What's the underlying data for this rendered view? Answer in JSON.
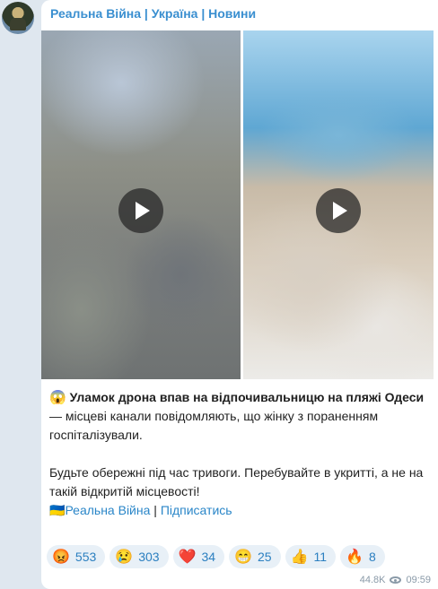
{
  "channel": {
    "title": "Реальна Війна | Україна | Новини",
    "avatar_icon": "soldier-avatar-icon"
  },
  "media": {
    "videos": [
      {
        "play_icon": "play-icon",
        "thumb": "beach-street-video"
      },
      {
        "play_icon": "play-icon",
        "thumb": "beach-sea-video"
      }
    ]
  },
  "post": {
    "headline_emoji": "😱",
    "headline": "Уламок дрона впав на відпочивальницю на пляжі Одеси",
    "headline_rest": " — місцеві канали повідомляють, що жінку з пораненням госпіталізували.",
    "paragraph2": "Будьте обережні під час тривоги. Перебувайте в укритті, а не на такій відкритій місцевості!",
    "flag_emoji": "🇺🇦",
    "channel_link": "Реальна Війна",
    "separator": " | ",
    "subscribe_link": "Підписатись"
  },
  "reactions": [
    {
      "emoji": "😡",
      "count": "553"
    },
    {
      "emoji": "😢",
      "count": "303"
    },
    {
      "emoji": "❤️",
      "count": "34"
    },
    {
      "emoji": "😁",
      "count": "25"
    },
    {
      "emoji": "👍",
      "count": "11"
    },
    {
      "emoji": "🔥",
      "count": "8"
    }
  ],
  "meta": {
    "views": "44.8K",
    "time": "09:59"
  },
  "colors": {
    "accent": "#3a8fd0",
    "link": "#2a86c8",
    "reaction_bg": "#e8f0f7"
  }
}
